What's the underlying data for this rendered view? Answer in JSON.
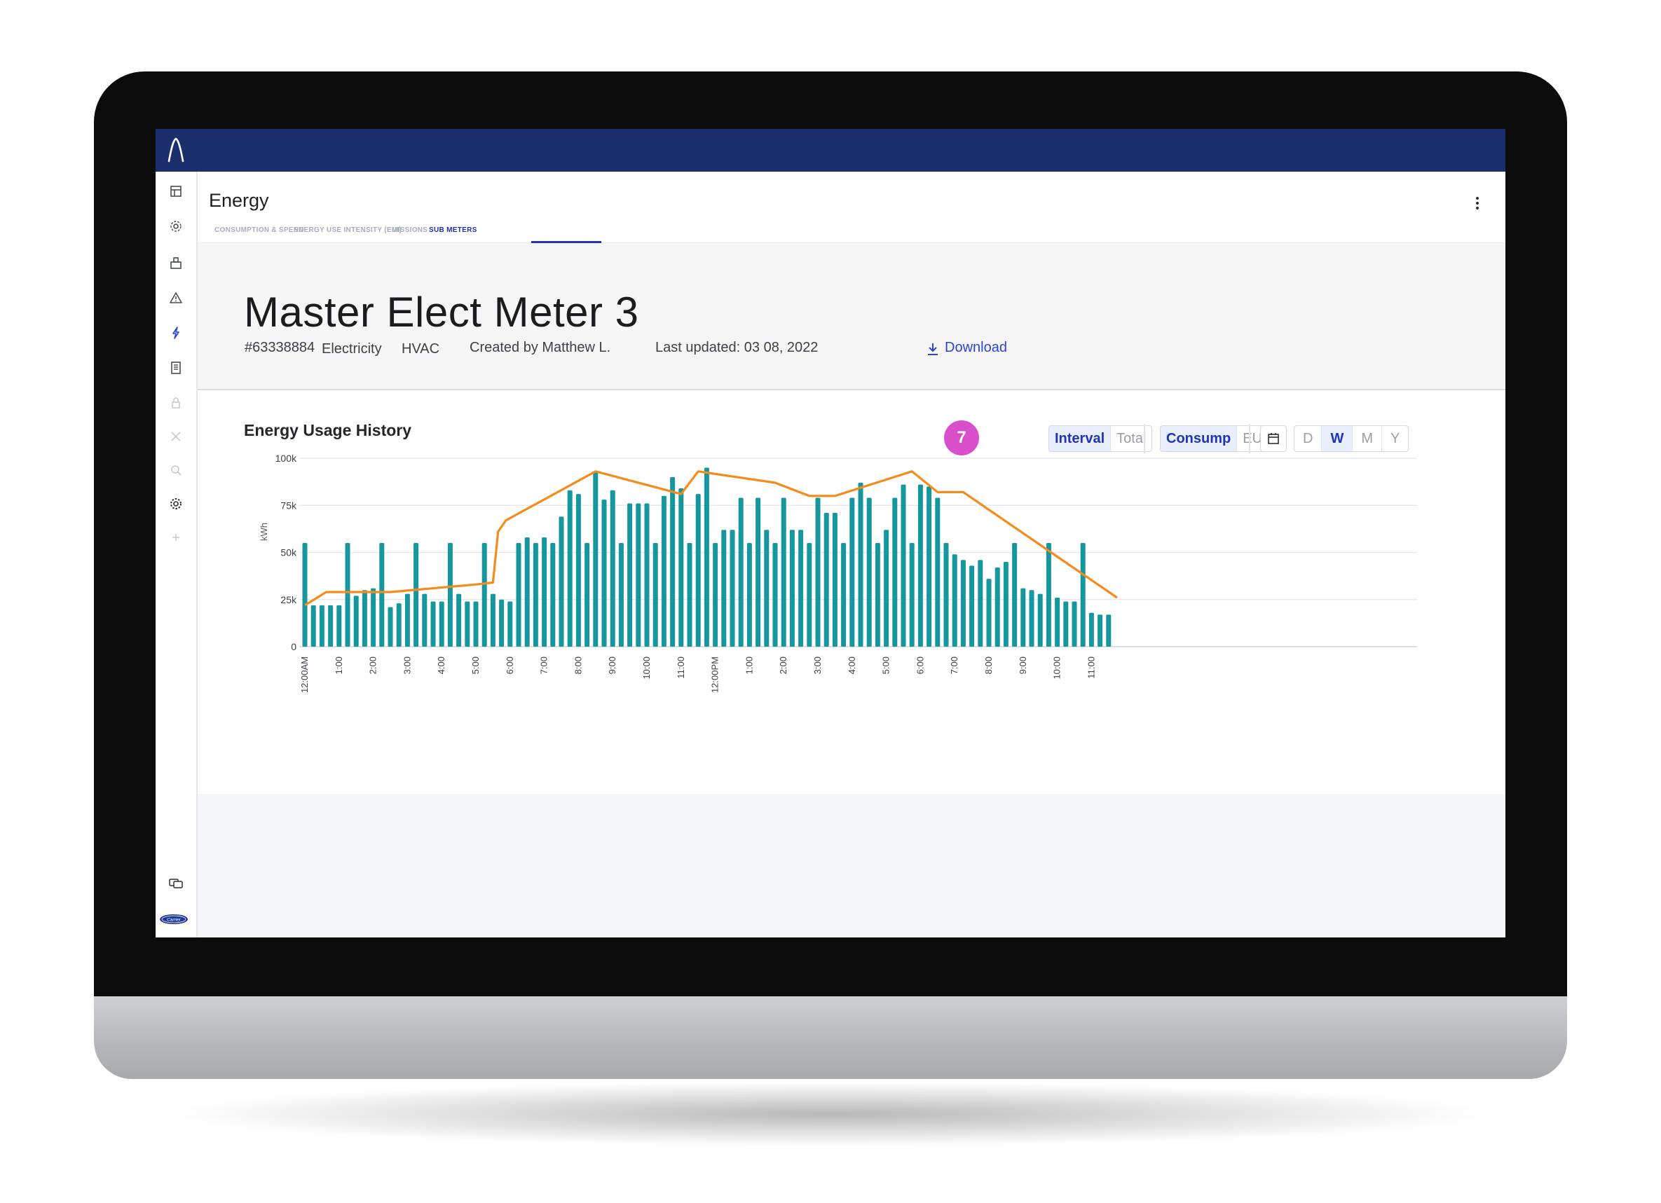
{
  "app": {
    "page_title": "Energy",
    "tabs": [
      {
        "label": "CONSUMPTION & SPEND",
        "active": false
      },
      {
        "label": "ENERGY USE INTENSITY (EUI)",
        "active": false
      },
      {
        "label": "EMISSIONS",
        "active": false
      },
      {
        "label": "SUB METERS",
        "active": true
      }
    ],
    "sidebar_icons": [
      "dashboard-icon",
      "devices-icon",
      "equipment-icon",
      "alert-icon",
      "energy-icon",
      "reports-icon",
      "lock-icon",
      "tools-icon",
      "analytics-icon",
      "settings-icon",
      "add-icon",
      "feedback-icon"
    ],
    "brand_logo": "Carrier"
  },
  "meter": {
    "title": "Master Elect Meter 3",
    "id": "#63338884",
    "type": "Electricity",
    "category": "HVAC",
    "created_by": "Created by Matthew L.",
    "last_updated": "Last updated: 03 08, 2022",
    "download_label": "Download"
  },
  "usage": {
    "title": "Energy Usage History",
    "step_badge": "7",
    "mode_toggle": [
      {
        "label": "Interval",
        "selected": true
      },
      {
        "label": "Total",
        "selected": false
      }
    ],
    "metric_toggle": [
      {
        "label": "Consump",
        "selected": true
      },
      {
        "label": "EUI",
        "selected": false
      }
    ],
    "range_toggle": [
      {
        "label": "D",
        "selected": false
      },
      {
        "label": "W",
        "selected": true
      },
      {
        "label": "M",
        "selected": false
      },
      {
        "label": "Y",
        "selected": false
      }
    ]
  },
  "colors": {
    "topbar": "#1b2e6e",
    "accent": "#1f35b5",
    "bar": "#16979e",
    "line": "#f28c1c",
    "badge": "#d94fcb"
  },
  "chart_data": {
    "type": "bar",
    "ylabel": "kWh",
    "ylim": [
      0,
      100000
    ],
    "yticks": [
      0,
      25000,
      50000,
      75000,
      100000
    ],
    "ytick_labels": [
      "0",
      "25k",
      "50k",
      "75k",
      "100k"
    ],
    "xtick_labels": [
      "12:00AM",
      "1:00",
      "2:00",
      "3:00",
      "4:00",
      "5:00",
      "6:00",
      "7:00",
      "8:00",
      "9:00",
      "10:00",
      "11:00",
      "12:00PM",
      "1:00",
      "2:00",
      "3:00",
      "4:00",
      "5:00",
      "6:00",
      "7:00",
      "8:00",
      "9:00",
      "10:00",
      "11:00"
    ],
    "grid": true,
    "series": [
      {
        "type": "bar",
        "values": [
          55000,
          22000,
          22000,
          22000,
          22000,
          55000,
          27000,
          30000,
          31000,
          55000,
          21000,
          23000,
          28000,
          55000,
          28000,
          24000,
          24000,
          55000,
          28000,
          24000,
          24000,
          55000,
          28000,
          25000,
          24000,
          55000,
          58000,
          55000,
          58000,
          55000,
          69000,
          83000,
          81000,
          55000,
          93000,
          78000,
          83000,
          55000,
          76000,
          76000,
          76000,
          55000,
          80000,
          90000,
          84000,
          55000,
          81000,
          95000,
          55000,
          62000,
          62000,
          79000,
          55000,
          79000,
          62000,
          55000,
          79000,
          62000,
          62000,
          55000,
          79000,
          71000,
          71000,
          55000,
          79000,
          87000,
          79000,
          55000,
          62000,
          79000,
          86000,
          55000,
          86000,
          85000,
          79000,
          55000,
          49000,
          46000,
          43000,
          46000,
          36000,
          42000,
          45000,
          55000,
          31000,
          30000,
          28000,
          55000,
          26000,
          24000,
          24000,
          55000,
          18000,
          17000,
          17000
        ]
      },
      {
        "type": "line",
        "points": [
          [
            0,
            22000
          ],
          [
            2.5,
            29000
          ],
          [
            10,
            29000
          ],
          [
            20,
            33000
          ],
          [
            22,
            34000
          ],
          [
            22.6,
            61000
          ],
          [
            23.5,
            67000
          ],
          [
            34,
            93000
          ],
          [
            44,
            81000
          ],
          [
            46,
            93000
          ],
          [
            55,
            87000
          ],
          [
            59,
            80000
          ],
          [
            62,
            80000
          ],
          [
            71,
            93000
          ],
          [
            74,
            82000
          ],
          [
            77,
            82000
          ],
          [
            95,
            26000
          ]
        ]
      }
    ]
  }
}
